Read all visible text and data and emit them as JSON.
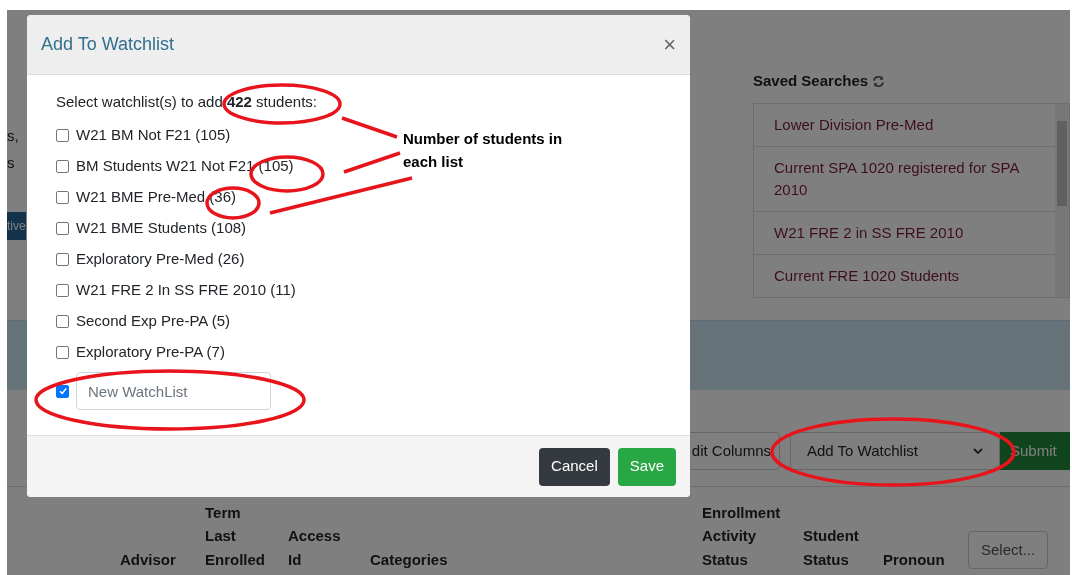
{
  "page": {
    "fragments": [
      "s,",
      "s"
    ],
    "side_button": "tive",
    "saved_searches": {
      "title": "Saved Searches",
      "items": [
        "Lower Division Pre-Med",
        "Current SPA 1020 registered for SPA 2010",
        "W21 FRE 2 in SS FRE 2010",
        "Current FRE 1020 Students"
      ]
    },
    "toolbar": {
      "edit_columns": "dit Columns",
      "action": "Add To Watchlist",
      "submit": "Submit"
    },
    "table": {
      "columns": [
        [
          "Advisor"
        ],
        [
          "Term",
          "Last",
          "Enrolled"
        ],
        [
          "Access",
          "Id"
        ],
        [
          "Categories"
        ],
        [
          "Enrollment",
          "Activity",
          "Status"
        ],
        [
          "Student",
          "Status"
        ],
        [
          "Pronoun"
        ]
      ],
      "select_button": "Select..."
    }
  },
  "dialog": {
    "title": "Add To Watchlist",
    "close": "×",
    "prompt": "Select watchlist(s) to add **422** students:",
    "watchlists": [
      {
        "label": "W21 BM Not F21 (105)",
        "checked": false
      },
      {
        "label": "BM Students W21 Not F21 (105)",
        "checked": false
      },
      {
        "label": "W21 BME Pre-Med (36)",
        "checked": false
      },
      {
        "label": "W21 BME Students (108)",
        "checked": false
      },
      {
        "label": "Exploratory Pre-Med (26)",
        "checked": false
      },
      {
        "label": "W21 FRE 2 In SS FRE 2010 (11)",
        "checked": false
      },
      {
        "label": "Second Exp Pre-PA (5)",
        "checked": false
      },
      {
        "label": "Exploratory Pre-PA (7)",
        "checked": false
      }
    ],
    "new_watchlist": {
      "checked": true,
      "placeholder": "New WatchList"
    },
    "buttons": [
      {
        "label": "Cancel",
        "kind": "secondary"
      },
      {
        "label": "Save",
        "kind": "primary"
      }
    ]
  },
  "annotation": {
    "note": "Number of students in each list"
  }
}
